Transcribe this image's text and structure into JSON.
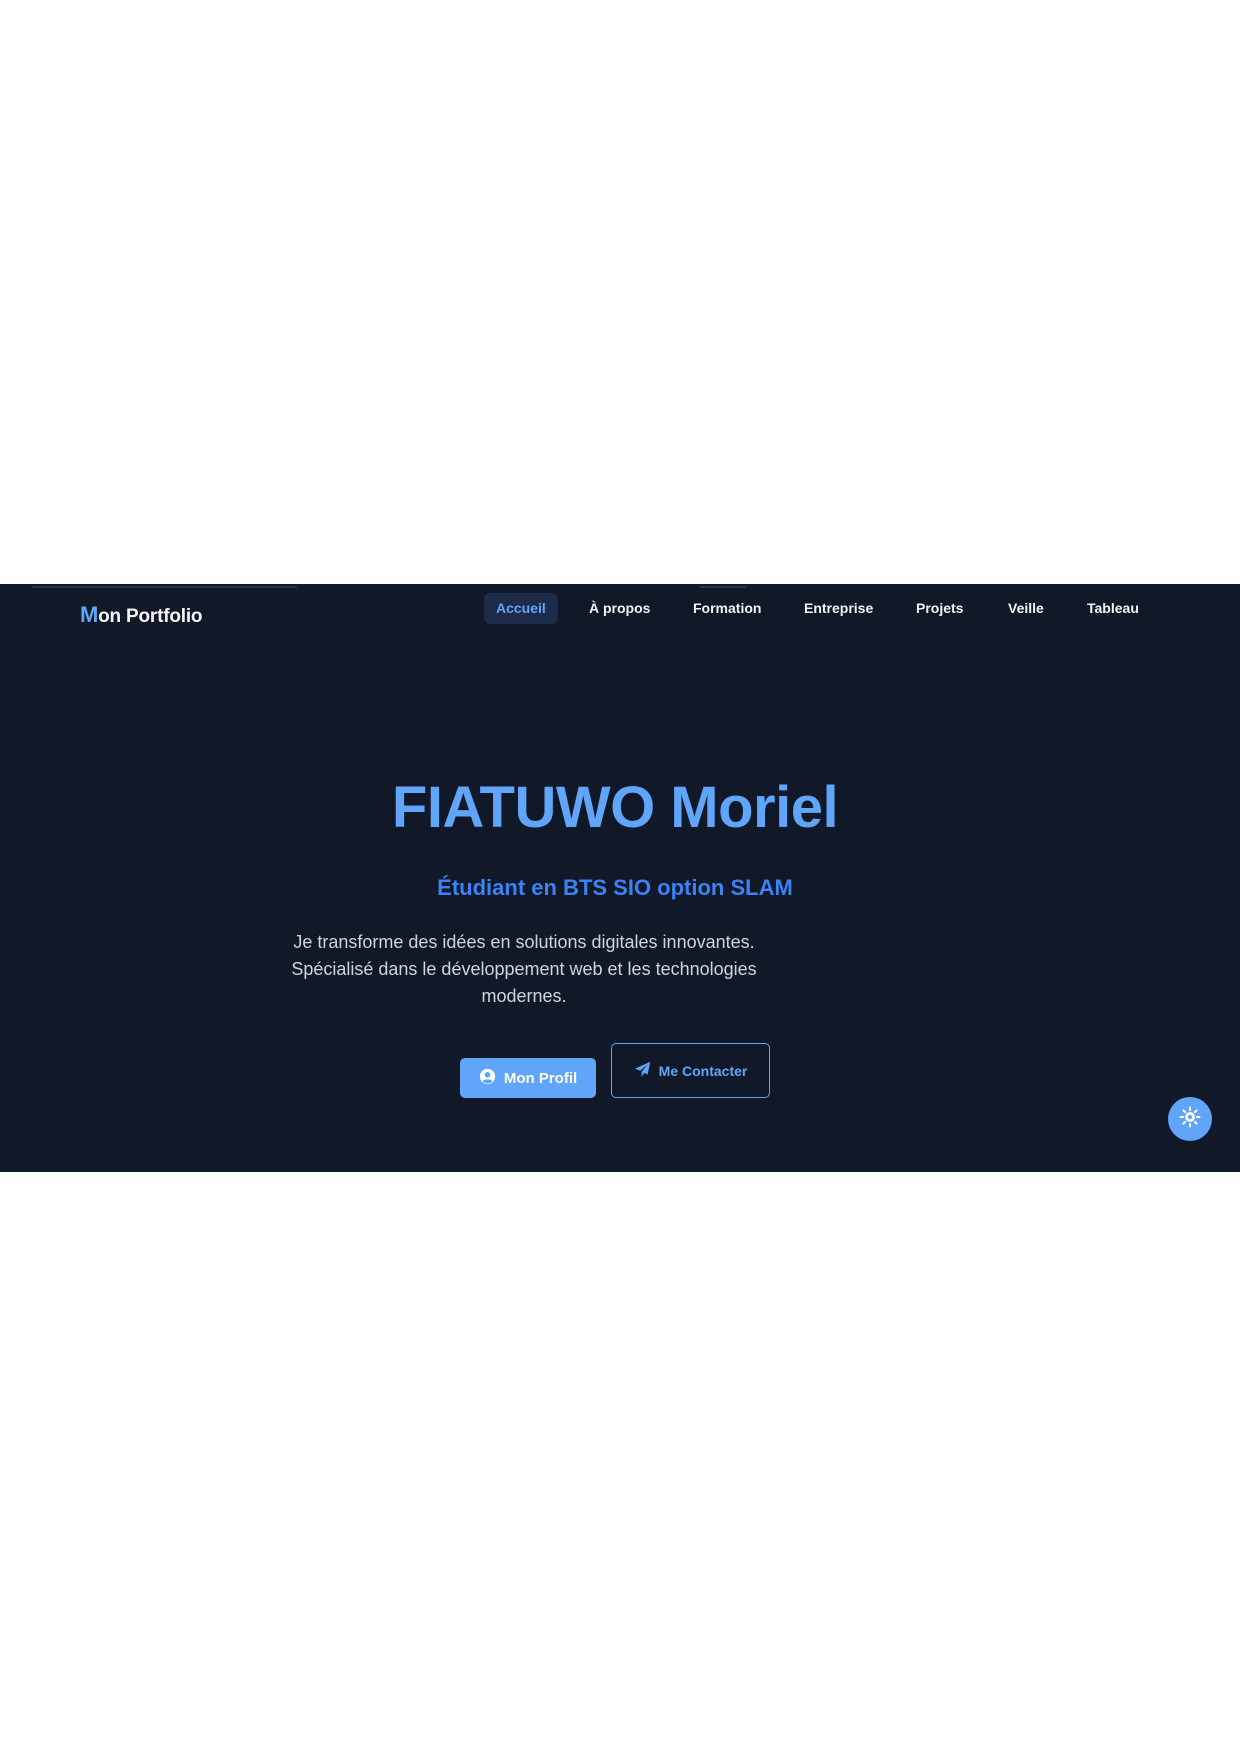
{
  "nav": {
    "logo_initial": "M",
    "logo_rest": "on Portfolio",
    "items": [
      {
        "label": "Accueil",
        "active": true
      },
      {
        "label": "À propos",
        "active": false
      },
      {
        "label": "Formation",
        "active": false
      },
      {
        "label": "Entreprise",
        "active": false
      },
      {
        "label": "Projets",
        "active": false
      },
      {
        "label": "Veille",
        "active": false
      },
      {
        "label": "Tableau",
        "active": false
      }
    ]
  },
  "hero": {
    "name": "FIATUWO Moriel",
    "subtitle": "Étudiant en BTS SIO option SLAM",
    "description": "Je transforme des idées en solutions digitales innovantes. Spécialisé dans le développement web et les technologies modernes.",
    "primary_button": {
      "label": "Mon Profil",
      "icon": "user-circle-icon"
    },
    "secondary_button": {
      "label": "Me Contacter",
      "icon": "paper-plane-icon"
    }
  },
  "theme_toggle": {
    "icon": "sun-icon"
  },
  "colors": {
    "background": "#111827",
    "accent": "#60a5fa",
    "accent_dark": "#3b82f6",
    "text": "#f3f4f6",
    "muted_text": "#d1d5db",
    "page": "#fdfdfd"
  }
}
